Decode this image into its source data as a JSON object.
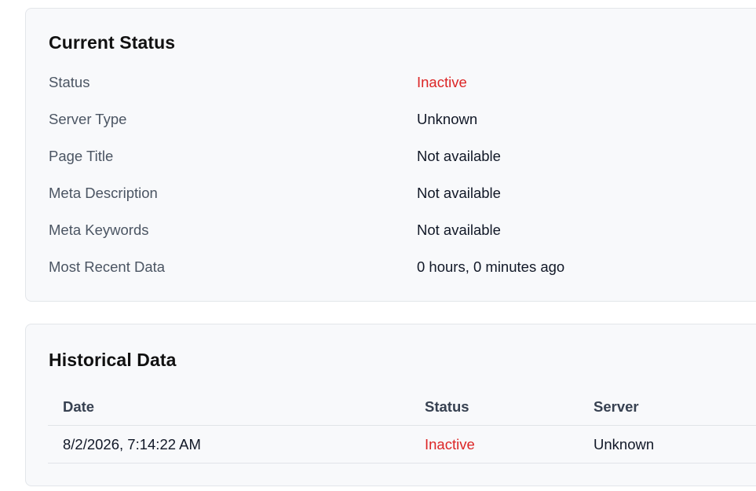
{
  "current_status": {
    "title": "Current Status",
    "rows": [
      {
        "label": "Status",
        "value": "Inactive"
      },
      {
        "label": "Server Type",
        "value": "Unknown"
      },
      {
        "label": "Page Title",
        "value": "Not available"
      },
      {
        "label": "Meta Description",
        "value": "Not available"
      },
      {
        "label": "Meta Keywords",
        "value": "Not available"
      },
      {
        "label": "Most Recent Data",
        "value": "0 hours, 0 minutes ago"
      }
    ]
  },
  "historical_data": {
    "title": "Historical Data",
    "headers": {
      "date": "Date",
      "status": "Status",
      "server": "Server"
    },
    "rows": [
      {
        "date": "8/2/2026, 7:14:22 AM",
        "status": "Inactive",
        "server": "Unknown"
      }
    ]
  },
  "colors": {
    "inactive": "#dc2626",
    "card_background": "#f8f9fb",
    "border": "#e3e6ea"
  }
}
